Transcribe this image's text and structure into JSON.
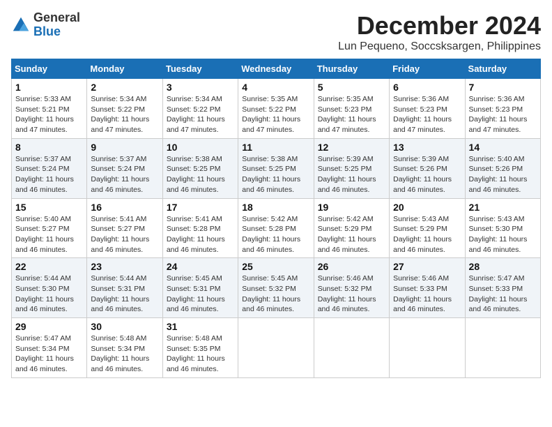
{
  "logo": {
    "general": "General",
    "blue": "Blue"
  },
  "header": {
    "month": "December 2024",
    "location": "Lun Pequeno, Soccsksargen, Philippines"
  },
  "weekdays": [
    "Sunday",
    "Monday",
    "Tuesday",
    "Wednesday",
    "Thursday",
    "Friday",
    "Saturday"
  ],
  "weeks": [
    [
      {
        "day": "1",
        "sunrise": "5:33 AM",
        "sunset": "5:21 PM",
        "daylight": "11 hours and 47 minutes."
      },
      {
        "day": "2",
        "sunrise": "5:34 AM",
        "sunset": "5:22 PM",
        "daylight": "11 hours and 47 minutes."
      },
      {
        "day": "3",
        "sunrise": "5:34 AM",
        "sunset": "5:22 PM",
        "daylight": "11 hours and 47 minutes."
      },
      {
        "day": "4",
        "sunrise": "5:35 AM",
        "sunset": "5:22 PM",
        "daylight": "11 hours and 47 minutes."
      },
      {
        "day": "5",
        "sunrise": "5:35 AM",
        "sunset": "5:23 PM",
        "daylight": "11 hours and 47 minutes."
      },
      {
        "day": "6",
        "sunrise": "5:36 AM",
        "sunset": "5:23 PM",
        "daylight": "11 hours and 47 minutes."
      },
      {
        "day": "7",
        "sunrise": "5:36 AM",
        "sunset": "5:23 PM",
        "daylight": "11 hours and 47 minutes."
      }
    ],
    [
      {
        "day": "8",
        "sunrise": "5:37 AM",
        "sunset": "5:24 PM",
        "daylight": "11 hours and 46 minutes."
      },
      {
        "day": "9",
        "sunrise": "5:37 AM",
        "sunset": "5:24 PM",
        "daylight": "11 hours and 46 minutes."
      },
      {
        "day": "10",
        "sunrise": "5:38 AM",
        "sunset": "5:25 PM",
        "daylight": "11 hours and 46 minutes."
      },
      {
        "day": "11",
        "sunrise": "5:38 AM",
        "sunset": "5:25 PM",
        "daylight": "11 hours and 46 minutes."
      },
      {
        "day": "12",
        "sunrise": "5:39 AM",
        "sunset": "5:25 PM",
        "daylight": "11 hours and 46 minutes."
      },
      {
        "day": "13",
        "sunrise": "5:39 AM",
        "sunset": "5:26 PM",
        "daylight": "11 hours and 46 minutes."
      },
      {
        "day": "14",
        "sunrise": "5:40 AM",
        "sunset": "5:26 PM",
        "daylight": "11 hours and 46 minutes."
      }
    ],
    [
      {
        "day": "15",
        "sunrise": "5:40 AM",
        "sunset": "5:27 PM",
        "daylight": "11 hours and 46 minutes."
      },
      {
        "day": "16",
        "sunrise": "5:41 AM",
        "sunset": "5:27 PM",
        "daylight": "11 hours and 46 minutes."
      },
      {
        "day": "17",
        "sunrise": "5:41 AM",
        "sunset": "5:28 PM",
        "daylight": "11 hours and 46 minutes."
      },
      {
        "day": "18",
        "sunrise": "5:42 AM",
        "sunset": "5:28 PM",
        "daylight": "11 hours and 46 minutes."
      },
      {
        "day": "19",
        "sunrise": "5:42 AM",
        "sunset": "5:29 PM",
        "daylight": "11 hours and 46 minutes."
      },
      {
        "day": "20",
        "sunrise": "5:43 AM",
        "sunset": "5:29 PM",
        "daylight": "11 hours and 46 minutes."
      },
      {
        "day": "21",
        "sunrise": "5:43 AM",
        "sunset": "5:30 PM",
        "daylight": "11 hours and 46 minutes."
      }
    ],
    [
      {
        "day": "22",
        "sunrise": "5:44 AM",
        "sunset": "5:30 PM",
        "daylight": "11 hours and 46 minutes."
      },
      {
        "day": "23",
        "sunrise": "5:44 AM",
        "sunset": "5:31 PM",
        "daylight": "11 hours and 46 minutes."
      },
      {
        "day": "24",
        "sunrise": "5:45 AM",
        "sunset": "5:31 PM",
        "daylight": "11 hours and 46 minutes."
      },
      {
        "day": "25",
        "sunrise": "5:45 AM",
        "sunset": "5:32 PM",
        "daylight": "11 hours and 46 minutes."
      },
      {
        "day": "26",
        "sunrise": "5:46 AM",
        "sunset": "5:32 PM",
        "daylight": "11 hours and 46 minutes."
      },
      {
        "day": "27",
        "sunrise": "5:46 AM",
        "sunset": "5:33 PM",
        "daylight": "11 hours and 46 minutes."
      },
      {
        "day": "28",
        "sunrise": "5:47 AM",
        "sunset": "5:33 PM",
        "daylight": "11 hours and 46 minutes."
      }
    ],
    [
      {
        "day": "29",
        "sunrise": "5:47 AM",
        "sunset": "5:34 PM",
        "daylight": "11 hours and 46 minutes."
      },
      {
        "day": "30",
        "sunrise": "5:48 AM",
        "sunset": "5:34 PM",
        "daylight": "11 hours and 46 minutes."
      },
      {
        "day": "31",
        "sunrise": "5:48 AM",
        "sunset": "5:35 PM",
        "daylight": "11 hours and 46 minutes."
      },
      null,
      null,
      null,
      null
    ]
  ]
}
